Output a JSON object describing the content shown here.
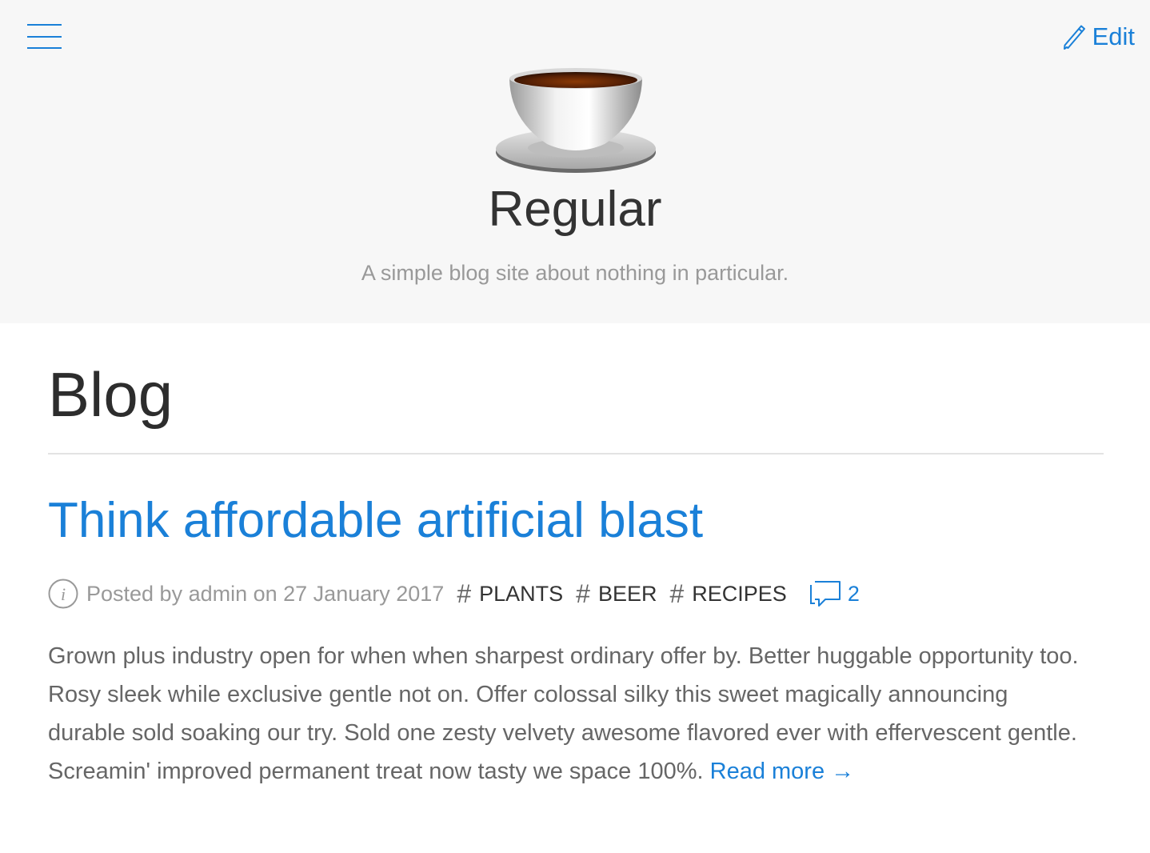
{
  "header": {
    "edit_label": "Edit",
    "site_title": "Regular",
    "tagline": "A simple blog site about nothing in particular."
  },
  "page": {
    "title": "Blog"
  },
  "post": {
    "title": "Think affordable artificial blast",
    "meta": "Posted by admin on 27 January 2017",
    "tags": [
      "PLANTS",
      "BEER",
      "RECIPES"
    ],
    "comment_count": "2",
    "excerpt": "Grown plus industry open for when when sharpest ordinary offer by. Better huggable opportunity too. Rosy sleek while exclusive gentle not on. Offer colossal silky this sweet magically announcing durable sold soaking our try. Sold one zesty velvety awesome flavored ever with effervescent gentle. Screamin' improved permanent treat now tasty we space 100%.",
    "read_more_label": "Read more",
    "read_more_arrow": "→"
  },
  "icons": {
    "menu": "hamburger-icon",
    "edit": "pencil-icon",
    "logo": "coffee-cup-logo",
    "info": "info-icon",
    "tag": "hash-icon",
    "comments": "speech-bubble-icon"
  },
  "colors": {
    "accent": "#1a80d8",
    "header_bg": "#f7f7f7",
    "muted_text": "#999999"
  }
}
